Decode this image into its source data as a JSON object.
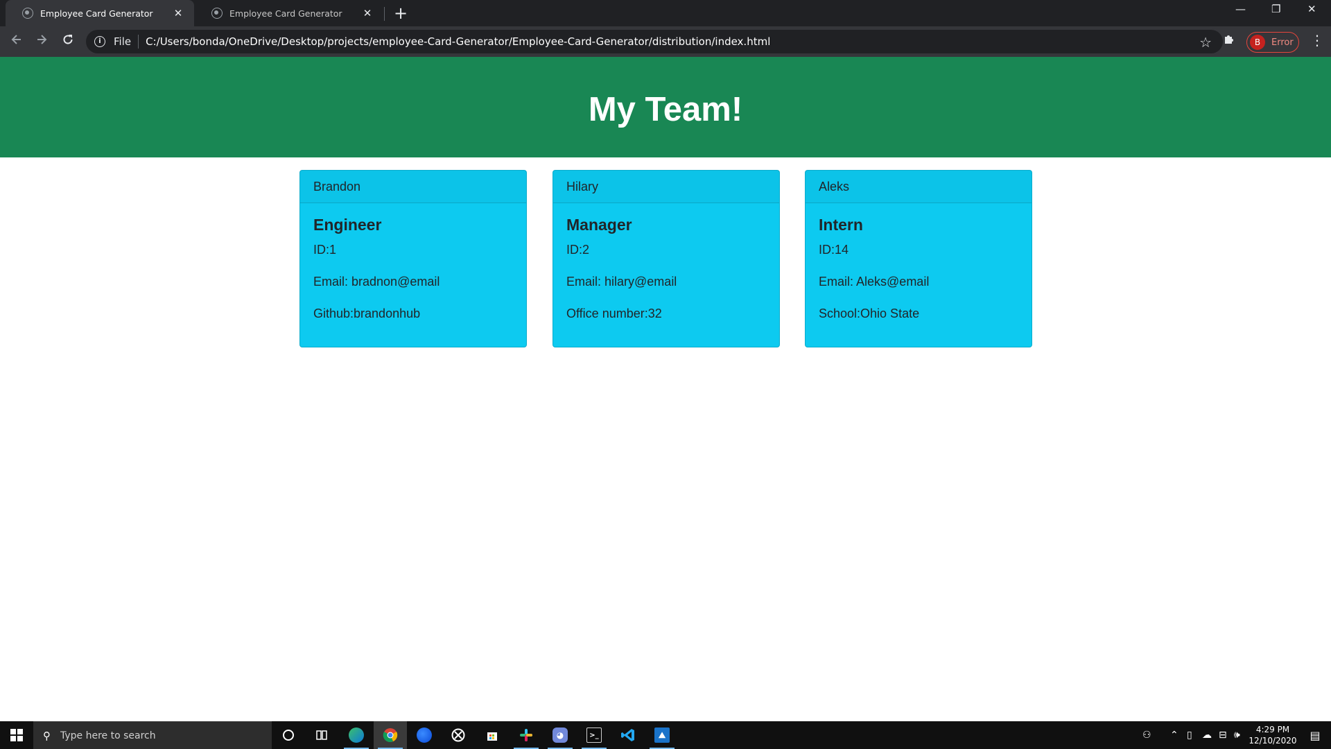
{
  "browser": {
    "tabs": [
      {
        "title": "Employee Card Generator",
        "active": true
      },
      {
        "title": "Employee Card Generator",
        "active": false
      }
    ],
    "close_glyph": "✕",
    "new_tab_glyph": "+",
    "window_controls": {
      "minimize": "—",
      "restore": "❐",
      "close": "✕"
    },
    "address": {
      "scheme_label": "File",
      "url": "C:/Users/bonda/OneDrive/Desktop/projects/employee-Card-Generator/Employee-Card-Generator/distribution/index.html"
    },
    "profile": {
      "initial": "B",
      "status": "Error"
    },
    "icons": {
      "back": "arrow-left-icon",
      "forward": "arrow-right-icon",
      "reload": "reload-icon",
      "info": "info-icon",
      "bookmark": "star-icon",
      "extensions": "puzzle-icon",
      "menu": "kebab-menu-icon"
    }
  },
  "page": {
    "heading": "My Team!",
    "header_color": "#198754",
    "card_color": "#0dcaf0",
    "cards": [
      {
        "name": "Brandon",
        "role": "Engineer",
        "id": "ID:1",
        "email": "Email: bradnon@email",
        "extra": "Github:brandonhub"
      },
      {
        "name": "Hilary",
        "role": "Manager",
        "id": "ID:2",
        "email": "Email: hilary@email",
        "extra": "Office number:32"
      },
      {
        "name": "Aleks",
        "role": "Intern",
        "id": "ID:14",
        "email": "Email: Aleks@email",
        "extra": "School:Ohio State"
      }
    ]
  },
  "taskbar": {
    "search_placeholder": "Type here to search",
    "pinned_icons": [
      "cortana-icon",
      "task-view-icon",
      "edge-icon",
      "chrome-icon",
      "firefox-icon",
      "xbox-icon",
      "store-icon",
      "slack-icon",
      "discord-icon",
      "terminal-icon",
      "vscode-icon",
      "photos-icon"
    ],
    "time": "4:29 PM",
    "date": "12/10/2020"
  }
}
